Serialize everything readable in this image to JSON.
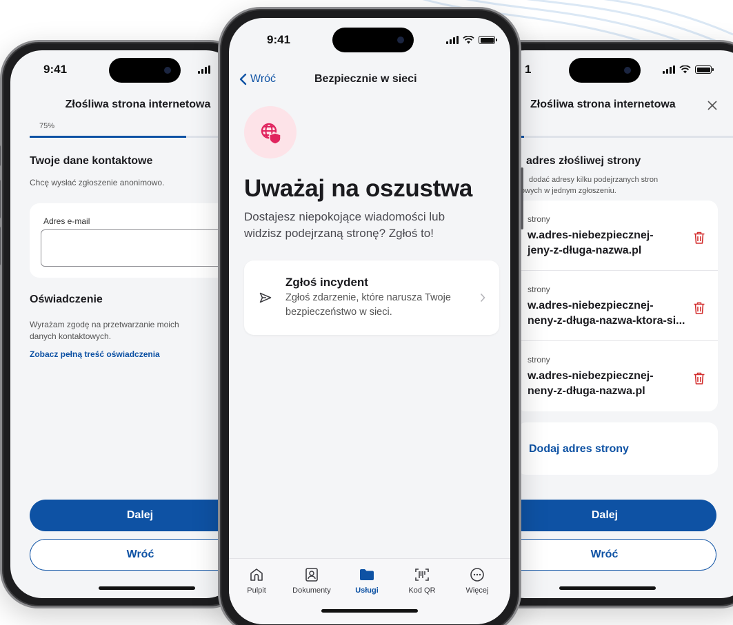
{
  "status_time": "9:41",
  "status_time_right": "1",
  "left": {
    "title": "Złośliwa strona internetowa",
    "progress_label": "75%",
    "progress": 0.75,
    "contact_heading": "Twoje dane kontaktowe",
    "anon_text": "Chcę wysłać zgłoszenie anonimowo.",
    "email_label": "Adres e-mail",
    "email_value": "",
    "declaration_heading": "Oświadczenie",
    "declaration_text_1": "Wyrażam zgodę na przetwarzanie moich",
    "declaration_text_2": "danych kontaktowych.",
    "declaration_link": "Zobacz pełną treść oświadczenia",
    "next_button": "Dalej",
    "back_button": "Wróć"
  },
  "center": {
    "back_label": "Wróć",
    "nav_title": "Bezpiecznie w sieci",
    "hero_title": "Uważaj na oszustwa",
    "hero_sub_1": "Dostajesz niepokojące wiadomości lub",
    "hero_sub_2": "widzisz podejrzaną stronę? Zgłoś to!",
    "incident_title": "Zgłoś incydent",
    "incident_desc_1": "Zgłoś zdarzenie, które narusza Twoje",
    "incident_desc_2": "bezpieczeństwo w sieci.",
    "tabs": [
      {
        "label": "Pulpit",
        "icon": "home-icon"
      },
      {
        "label": "Dokumenty",
        "icon": "id-card-icon"
      },
      {
        "label": "Usługi",
        "icon": "folder-icon"
      },
      {
        "label": "Kod QR",
        "icon": "qr-scan-icon"
      },
      {
        "label": "Więcej",
        "icon": "more-icon"
      }
    ],
    "active_tab": "Usługi"
  },
  "right": {
    "title": "Złośliwa strona internetowa",
    "progress": 0.12,
    "heading": "adres złośliwej strony",
    "sub_1": "dodać adresy kilku podejrzanych stron",
    "sub_2": "owych w jednym zgłoszeniu.",
    "urls": [
      {
        "label": "strony",
        "line1": "w.adres-niebezpiecznej-",
        "line2": "jeny-z-długa-nazwa.pl"
      },
      {
        "label": "strony",
        "line1": "w.adres-niebezpiecznej-",
        "line2": "neny-z-długa-nazwa-ktora-si..."
      },
      {
        "label": "strony",
        "line1": "w.adres-niebezpiecznej-",
        "line2": "neny-z-długa-nazwa.pl"
      }
    ],
    "add_button": "Dodaj adres strony",
    "next_button": "Dalej",
    "back_button": "Wróć"
  },
  "colors": {
    "primary": "#0e52a4",
    "danger": "#d32f2f",
    "accent_pink": "#e0245e",
    "pink_bg": "#fde3e8"
  }
}
